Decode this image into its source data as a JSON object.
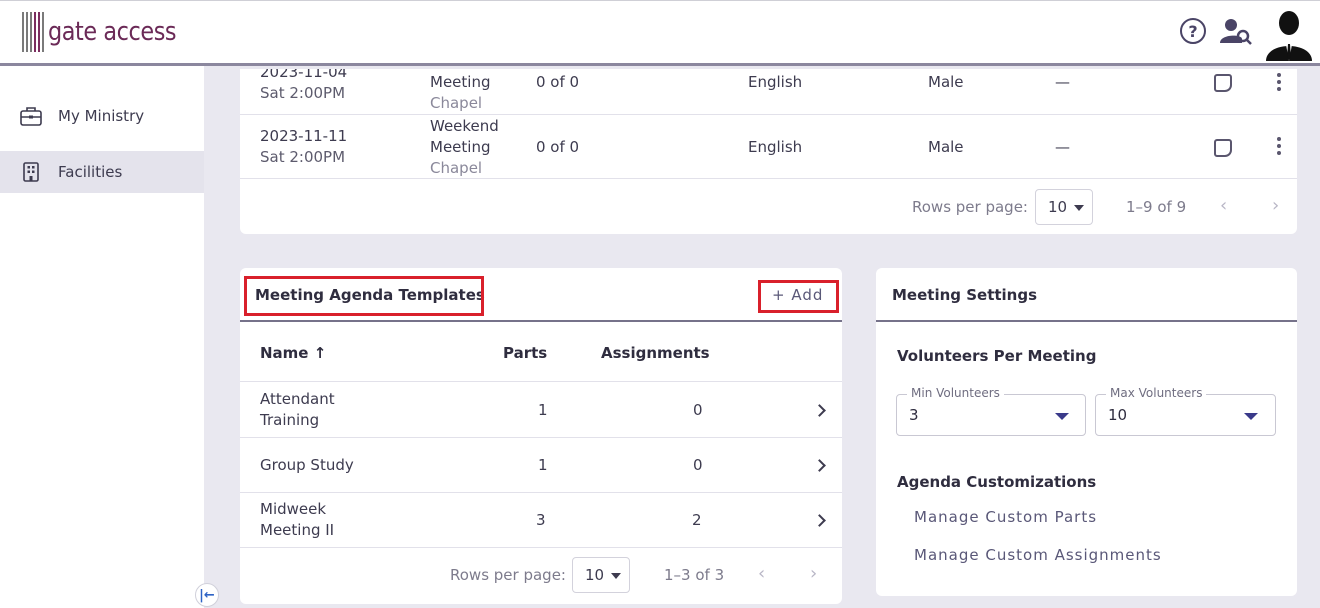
{
  "header": {
    "logo_text": "gate access",
    "help_glyph": "?",
    "icons": [
      "help-circle-icon",
      "person-search-icon",
      "user-avatar"
    ]
  },
  "sidebar": {
    "items": [
      {
        "label": "My Ministry",
        "icon": "briefcase-icon",
        "active": false
      },
      {
        "label": "Facilities",
        "icon": "building-icon",
        "active": true
      }
    ],
    "collapse_glyph": "|←"
  },
  "meetings_table": {
    "rows": [
      {
        "date": "2023-11-04",
        "time": "Sat 2:00PM",
        "type": [
          "Meeting"
        ],
        "location": "Chapel",
        "volunteers": "0 of 0",
        "language": "English",
        "gender": "Male",
        "extra": "—"
      },
      {
        "date": "2023-11-11",
        "time": "Sat 2:00PM",
        "type": [
          "Weekend",
          "Meeting"
        ],
        "location": "Chapel",
        "volunteers": "0 of 0",
        "language": "English",
        "gender": "Male",
        "extra": "—"
      }
    ],
    "pagination": {
      "rows_per_page_label": "Rows per page:",
      "rows_per_page": "10",
      "range": "1–9 of 9"
    }
  },
  "templates": {
    "title": "Meeting Agenda Templates",
    "add_label": "+ Add",
    "columns": {
      "name": "Name ↑",
      "parts": "Parts",
      "assignments": "Assignments"
    },
    "rows": [
      {
        "name": [
          "Attendant",
          "Training"
        ],
        "parts": "1",
        "assignments": "0"
      },
      {
        "name": [
          "Group Study"
        ],
        "parts": "1",
        "assignments": "0"
      },
      {
        "name": [
          "Midweek",
          "Meeting II"
        ],
        "parts": "3",
        "assignments": "2"
      }
    ],
    "pagination": {
      "rows_per_page_label": "Rows per page:",
      "rows_per_page": "10",
      "range": "1–3 of 3"
    }
  },
  "settings": {
    "title": "Meeting Settings",
    "volunteers_heading": "Volunteers Per Meeting",
    "min_label": "Min Volunteers",
    "min_value": "3",
    "max_label": "Max Volunteers",
    "max_value": "10",
    "agenda_heading": "Agenda Customizations",
    "link_parts": "Manage Custom Parts",
    "link_assignments": "Manage Custom Assignments"
  },
  "colors": {
    "accent": "#6b2a57",
    "highlight": "#d9202b",
    "link": "#5a5878"
  }
}
